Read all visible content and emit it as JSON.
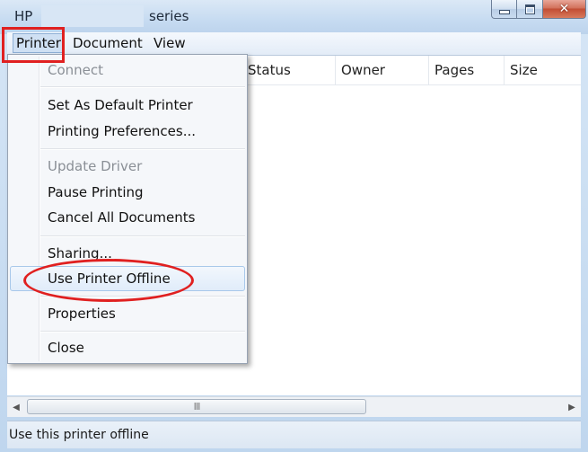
{
  "window": {
    "title_prefix": "HP",
    "title_suffix": "series"
  },
  "menubar": {
    "items": [
      "Printer",
      "Document",
      "View"
    ]
  },
  "columns": [
    "Status",
    "Owner",
    "Pages",
    "Size"
  ],
  "dropdown": {
    "items": [
      {
        "label": "Connect",
        "disabled": true
      },
      {
        "label": "Set As Default Printer",
        "disabled": false
      },
      {
        "label": "Printing Preferences...",
        "disabled": false
      },
      {
        "label": "Update Driver",
        "disabled": true
      },
      {
        "label": "Pause Printing",
        "disabled": false
      },
      {
        "label": "Cancel All Documents",
        "disabled": false
      },
      {
        "label": "Sharing...",
        "disabled": false
      },
      {
        "label": "Use Printer Offline",
        "disabled": false
      },
      {
        "label": "Properties",
        "disabled": false
      },
      {
        "label": "Close",
        "disabled": false
      }
    ]
  },
  "statusbar": {
    "text": "Use this printer offline"
  },
  "scrollbar": {
    "grip": "III"
  },
  "icons": {
    "close": "✕",
    "scroll_left": "◀",
    "scroll_right": "▶"
  },
  "colors": {
    "highlight_red": "#e02020",
    "hover_blue": "#a8c8ea"
  }
}
